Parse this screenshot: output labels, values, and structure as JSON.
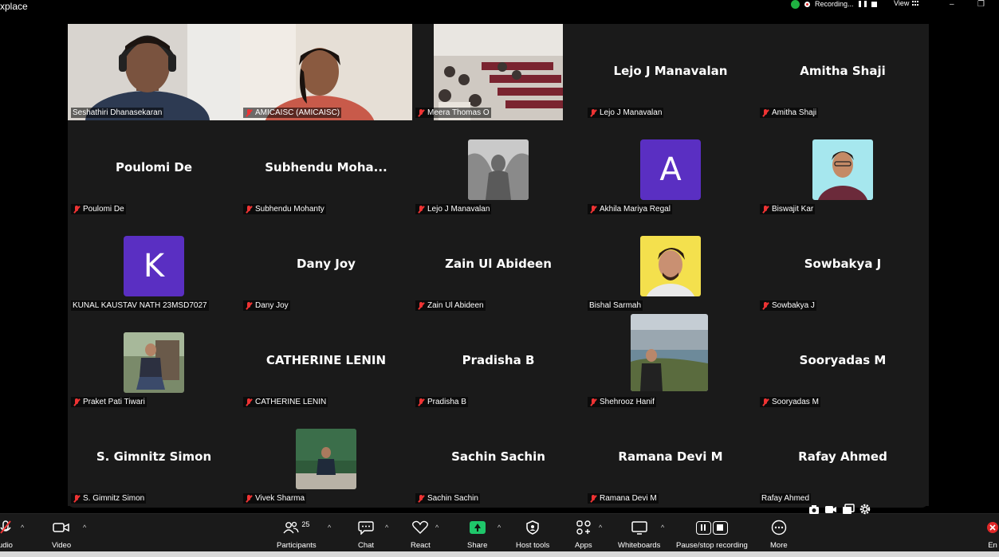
{
  "window": {
    "title": "xplace",
    "recording_label": "Recording...",
    "view_label": "View",
    "minimize": "–",
    "restore": "❐"
  },
  "participants": [
    {
      "label": "Seshathiri Dhanasekaran",
      "big": "",
      "kind": "video",
      "muted": false,
      "active": true
    },
    {
      "label": "AMICAISC (AMICAISC)",
      "big": "",
      "kind": "video",
      "muted": true
    },
    {
      "label": "Meera Thomas O",
      "big": "",
      "kind": "video",
      "muted": true
    },
    {
      "label": "Lejo J Manavalan",
      "big": "Lejo J Manavalan",
      "kind": "name",
      "muted": true
    },
    {
      "label": "Amitha Shaji",
      "big": "Amitha Shaji",
      "kind": "name",
      "muted": true
    },
    {
      "label": "Poulomi De",
      "big": "Poulomi De",
      "kind": "name",
      "muted": true
    },
    {
      "label": "Subhendu Mohanty",
      "big": "Subhendu  Moha...",
      "kind": "name",
      "muted": true
    },
    {
      "label": "Lejo J Manavalan",
      "big": "",
      "kind": "photo",
      "muted": true
    },
    {
      "label": "Akhila Mariya Regal",
      "big": "A",
      "kind": "avatar",
      "color": "#5a2fc2",
      "muted": true
    },
    {
      "label": "Biswajit Kar",
      "big": "",
      "kind": "photo",
      "muted": true
    },
    {
      "label": "KUNAL KAUSTAV NATH 23MSD7027",
      "big": "K",
      "kind": "avatar",
      "color": "#5a2fc2",
      "muted": false
    },
    {
      "label": "Dany Joy",
      "big": "Dany Joy",
      "kind": "name",
      "muted": true
    },
    {
      "label": "Zain Ul Abideen",
      "big": "Zain Ul Abideen",
      "kind": "name",
      "muted": true
    },
    {
      "label": "Bishal Sarmah",
      "big": "",
      "kind": "photo",
      "muted": false
    },
    {
      "label": "Sowbakya J",
      "big": "Sowbakya J",
      "kind": "name",
      "muted": true
    },
    {
      "label": "Praket Pati Tiwari",
      "big": "",
      "kind": "photo",
      "muted": true
    },
    {
      "label": "CATHERINE LENIN",
      "big": "CATHERINE LENIN",
      "kind": "name",
      "muted": true
    },
    {
      "label": "Pradisha B",
      "big": "Pradisha B",
      "kind": "name",
      "muted": true
    },
    {
      "label": "Shehrooz Hanif",
      "big": "",
      "kind": "photo",
      "muted": true
    },
    {
      "label": "Sooryadas M",
      "big": "Sooryadas M",
      "kind": "name",
      "muted": true
    },
    {
      "label": "S. Gimnitz Simon",
      "big": "S. Gimnitz Simon",
      "kind": "name",
      "muted": true
    },
    {
      "label": "Vivek Sharma",
      "big": "",
      "kind": "photo",
      "muted": true
    },
    {
      "label": "Sachin Sachin",
      "big": "Sachin Sachin",
      "kind": "name",
      "muted": true
    },
    {
      "label": "Ramana Devi M",
      "big": "Ramana Devi M",
      "kind": "name",
      "muted": true
    },
    {
      "label": "Rafay Ahmed",
      "big": "Rafay Ahmed",
      "kind": "name",
      "muted": false
    }
  ],
  "toolbar": {
    "audio": "udio",
    "video": "Video",
    "participants": "Participants",
    "participants_count": "25",
    "chat": "Chat",
    "react": "React",
    "share": "Share",
    "host_tools": "Host tools",
    "apps": "Apps",
    "whiteboards": "Whiteboards",
    "pause_stop": "Pause/stop recording",
    "more": "More",
    "end": "En"
  },
  "colors": {
    "accent_green": "#23d959",
    "avatar_purple": "#5a2fc2",
    "mute_red": "#ee3333"
  }
}
